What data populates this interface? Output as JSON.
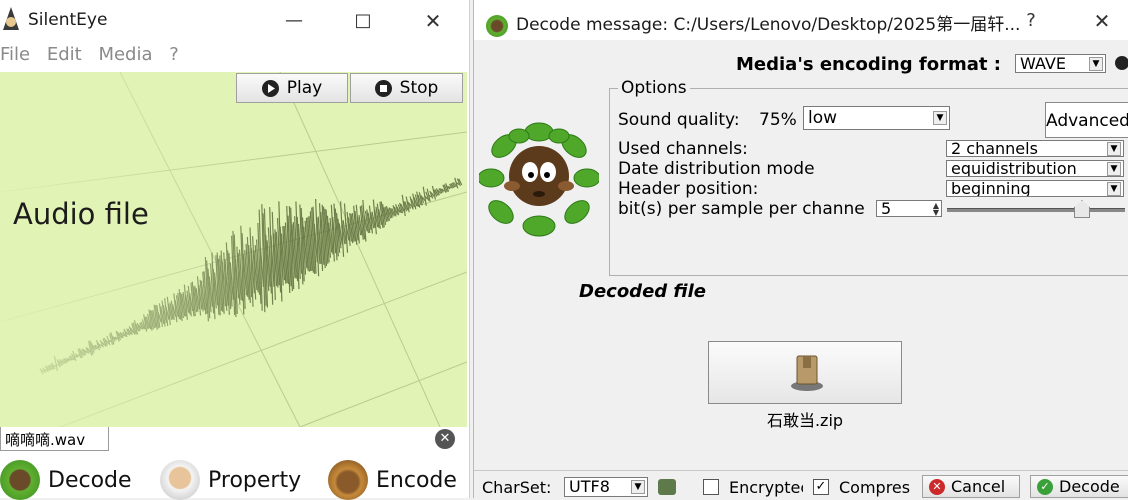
{
  "main_window": {
    "title": "SilentEye",
    "menu": [
      "File",
      "Edit",
      "Media",
      "?"
    ],
    "play_label": "Play",
    "stop_label": "Stop",
    "media_label": "Audio file",
    "file_tab": "嘀嘀嘀.wav",
    "actions": {
      "decode": "Decode",
      "property": "Property",
      "encode": "Encode"
    }
  },
  "dialog": {
    "title": "Decode message: C:/Users/Lenovo/Desktop/2025第一届轩...",
    "help": "?",
    "format_label": "Media's encoding format :",
    "format_value": "WAVE",
    "options_title": "Options",
    "sound_quality_label": "Sound quality:",
    "sound_quality_percent": "75%",
    "sound_quality_value": "low",
    "advanced_label": "Advanced",
    "used_channels_label": "Used channels:",
    "used_channels_value": "2 channels",
    "distribution_label": "Date distribution mode",
    "distribution_value": "equidistribution",
    "header_label": "Header position:",
    "header_value": "beginning",
    "bits_label": "bit(s) per sample per channe",
    "bits_value": "5",
    "decoded_file_title": "Decoded file",
    "decoded_file_name": "石敢当.zip",
    "charset_label": "CharSet:",
    "charset_value": "UTF8",
    "encrypted_label": "Encryptec",
    "encrypted_checked": false,
    "compressed_label": "Compres",
    "compressed_checked": true,
    "cancel_label": "Cancel",
    "decode_label": "Decode"
  },
  "colors": {
    "media_bg": "#e2f3b6",
    "wave": "#5b6b3a",
    "cancel_icon": "#cc2a2a",
    "decode_icon": "#3aa13a"
  }
}
